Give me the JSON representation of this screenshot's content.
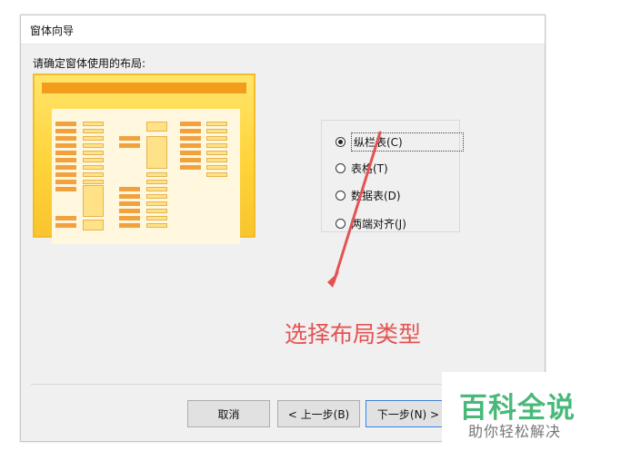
{
  "window": {
    "title": "窗体向导"
  },
  "layout_prompt": "请确定窗体使用的布局:",
  "options": [
    {
      "label": "纵栏表(C)",
      "selected": true
    },
    {
      "label": "表格(T)",
      "selected": false
    },
    {
      "label": "数据表(D)",
      "selected": false
    },
    {
      "label": "两端对齐(J)",
      "selected": false
    }
  ],
  "annotation_text": "选择布局类型",
  "buttons": {
    "cancel": "取消",
    "back": "< 上一步(B)",
    "next": "下一步(N) >"
  },
  "watermark": {
    "title": "百科全说",
    "subtitle": "助你轻松解决"
  },
  "colors": {
    "annotation": "#e45353",
    "watermark_title": "#49b97a"
  }
}
